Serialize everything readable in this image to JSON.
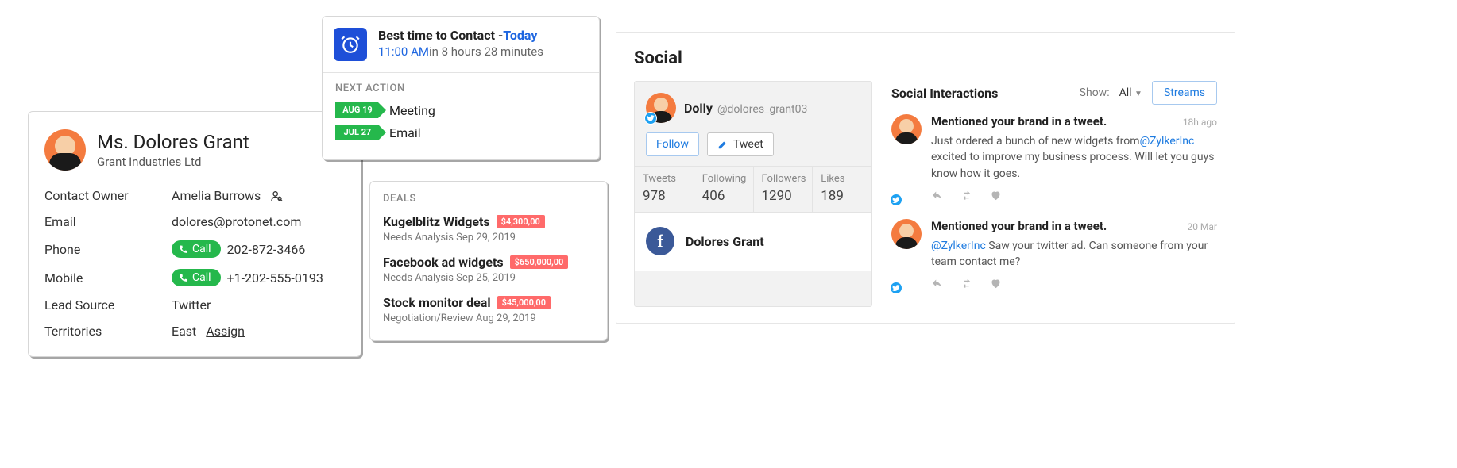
{
  "contact": {
    "name": "Ms. Dolores Grant",
    "company": "Grant Industries Ltd",
    "rows": {
      "owner_label": "Contact Owner",
      "owner_value": "Amelia Burrows",
      "email_label": "Email",
      "email_value": "dolores@protonet.com",
      "phone_label": "Phone",
      "phone_value": "202-872-3466",
      "mobile_label": "Mobile",
      "mobile_value": "+1-202-555-0193",
      "lead_label": "Lead Source",
      "lead_value": "Twitter",
      "terr_label": "Territories",
      "terr_value": "East ",
      "assign_label": "Assign",
      "call_button": "Call"
    }
  },
  "best_time": {
    "title_prefix": "Best time to Contact -",
    "title_suffix": "Today",
    "time": "11:00 AM",
    "time_rel": "in 8 hours 28 minutes",
    "next_action_label": "NEXT ACTION",
    "actions": [
      {
        "date": "AUG 19",
        "label": "Meeting"
      },
      {
        "date": "JUL 27",
        "label": "Email"
      }
    ]
  },
  "deals": {
    "label": "DEALS",
    "items": [
      {
        "name": "Kugelblitz Widgets",
        "amount": "$4,300,00",
        "sub": "Needs Analysis Sep 29, 2019"
      },
      {
        "name": "Facebook ad widgets",
        "amount": "$650,000,00",
        "sub": "Needs Analysis Sep 25, 2019"
      },
      {
        "name": "Stock monitor deal",
        "amount": "$45,000,00",
        "sub": "Negotiation/Review Aug 29, 2019"
      }
    ]
  },
  "social": {
    "title": "Social",
    "profile": {
      "display": "Dolly",
      "handle": "@dolores_grant03",
      "follow_btn": "Follow",
      "tweet_btn": "Tweet",
      "stats": [
        {
          "label": "Tweets",
          "value": "978"
        },
        {
          "label": "Following",
          "value": "406"
        },
        {
          "label": "Followers",
          "value": "1290"
        },
        {
          "label": "Likes",
          "value": "189"
        }
      ],
      "fb_name": "Dolores Grant"
    },
    "interactions_header": {
      "title": "Social Interactions",
      "show_label": "Show:",
      "show_value": "All",
      "streams_btn": "Streams"
    },
    "interactions": [
      {
        "title": "Mentioned your brand in a tweet.",
        "time": "18h ago",
        "text_before": "Just ordered a bunch of new widgets from",
        "mention": "@ZylkerInc",
        "text_after": " excited to improve my business process. Will let you guys know how it goes."
      },
      {
        "title": "Mentioned your brand in a tweet.",
        "time": "20 Mar",
        "text_before": "",
        "mention": "@ZylkerInc",
        "text_after": " Saw your twitter ad. Can someone from your team contact me?"
      }
    ]
  }
}
